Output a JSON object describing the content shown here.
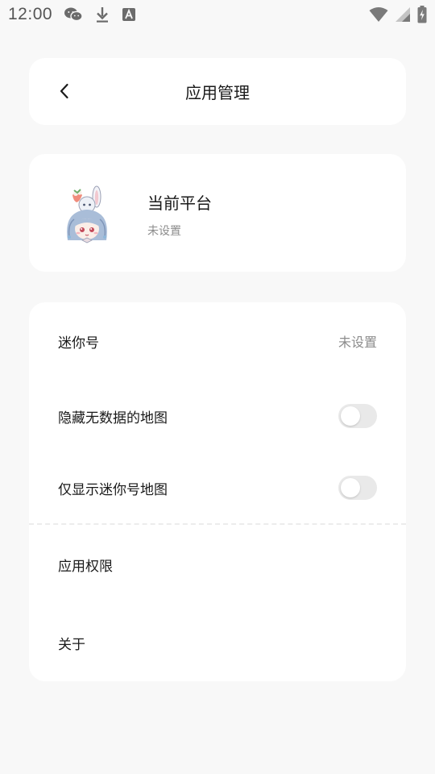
{
  "status_bar": {
    "time": "12:00",
    "left_icons": [
      "wechat-icon",
      "download-icon",
      "text-a-icon"
    ],
    "right_icons": [
      "wifi-icon",
      "signal-icon",
      "battery-charging-icon"
    ]
  },
  "header": {
    "back_icon": "chevron-left-icon",
    "title": "应用管理"
  },
  "platform": {
    "title": "当前平台",
    "subtitle": "未设置"
  },
  "settings": {
    "mini_id": {
      "label": "迷你号",
      "value": "未设置"
    },
    "hide_empty_maps": {
      "label": "隐藏无数据的地图",
      "enabled": false
    },
    "only_mini_maps": {
      "label": "仅显示迷你号地图",
      "enabled": false
    },
    "permissions": {
      "label": "应用权限"
    },
    "about": {
      "label": "关于"
    }
  },
  "colors": {
    "background": "#f8f8f8",
    "card": "#ffffff",
    "secondary_text": "#8c8c8c",
    "toggle_off": "#e9e9e9"
  }
}
